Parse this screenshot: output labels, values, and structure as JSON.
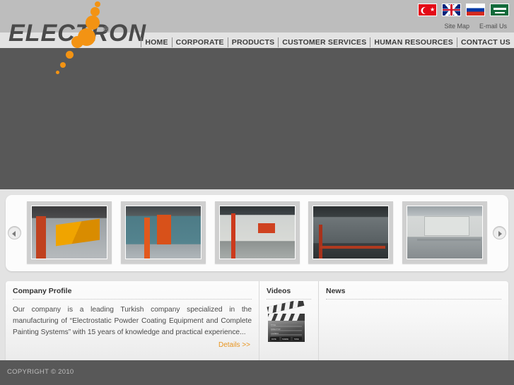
{
  "brand": {
    "wordmark": "ELECTRON",
    "registered_mark": "®",
    "accent_color": "#f39313"
  },
  "header": {
    "background_color": "#bdbdbd",
    "languages": [
      {
        "name": "turkish-flag",
        "label": "Türkçe"
      },
      {
        "name": "english-flag",
        "label": "English"
      },
      {
        "name": "russian-flag",
        "label": "Русский"
      },
      {
        "name": "saudi-arabia-flag",
        "label": "العربية"
      }
    ],
    "utility_links": [
      {
        "label": "Site Map"
      },
      {
        "label": "E-mail Us"
      }
    ],
    "nav": [
      {
        "label": "HOME"
      },
      {
        "label": "CORPORATE"
      },
      {
        "label": "PRODUCTS"
      },
      {
        "label": "CUSTOMER SERVICES"
      },
      {
        "label": "HUMAN RESOURCES"
      },
      {
        "label": "CONTACT US"
      }
    ]
  },
  "banner": {
    "background_color": "#585858"
  },
  "carousel": {
    "prev_label": "◀",
    "next_label": "▶",
    "slides": [
      {
        "alt": "powder-coating-booth-orange"
      },
      {
        "alt": "paint-line-conveyor-blue-tank"
      },
      {
        "alt": "coating-plant-interior-red-frame"
      },
      {
        "alt": "curing-oven-dark-workshop"
      },
      {
        "alt": "complete-painting-system-overview"
      }
    ]
  },
  "panels": {
    "profile": {
      "title": "Company Profile",
      "body": "Our company is a leading Turkish company specialized in the manufacturing of “Electrostatic Powder Coating Equipment and Complete Painting Systems” with 15 years of knowledge and practical experience...",
      "details_label": "Details >>",
      "details_color": "#e8941f"
    },
    "videos": {
      "title": "Videos",
      "thumbnail_alt": "clapperboard-icon",
      "clapper_fields": [
        "TITLE",
        "DIRECTOR",
        "CAMERA"
      ],
      "clapper_slots": [
        "DATE",
        "SCENE",
        "TAKE"
      ]
    },
    "news": {
      "title": "News",
      "items": []
    }
  },
  "footer": {
    "copyright": "COPYRIGHT © 2010",
    "background_color": "#585858"
  }
}
